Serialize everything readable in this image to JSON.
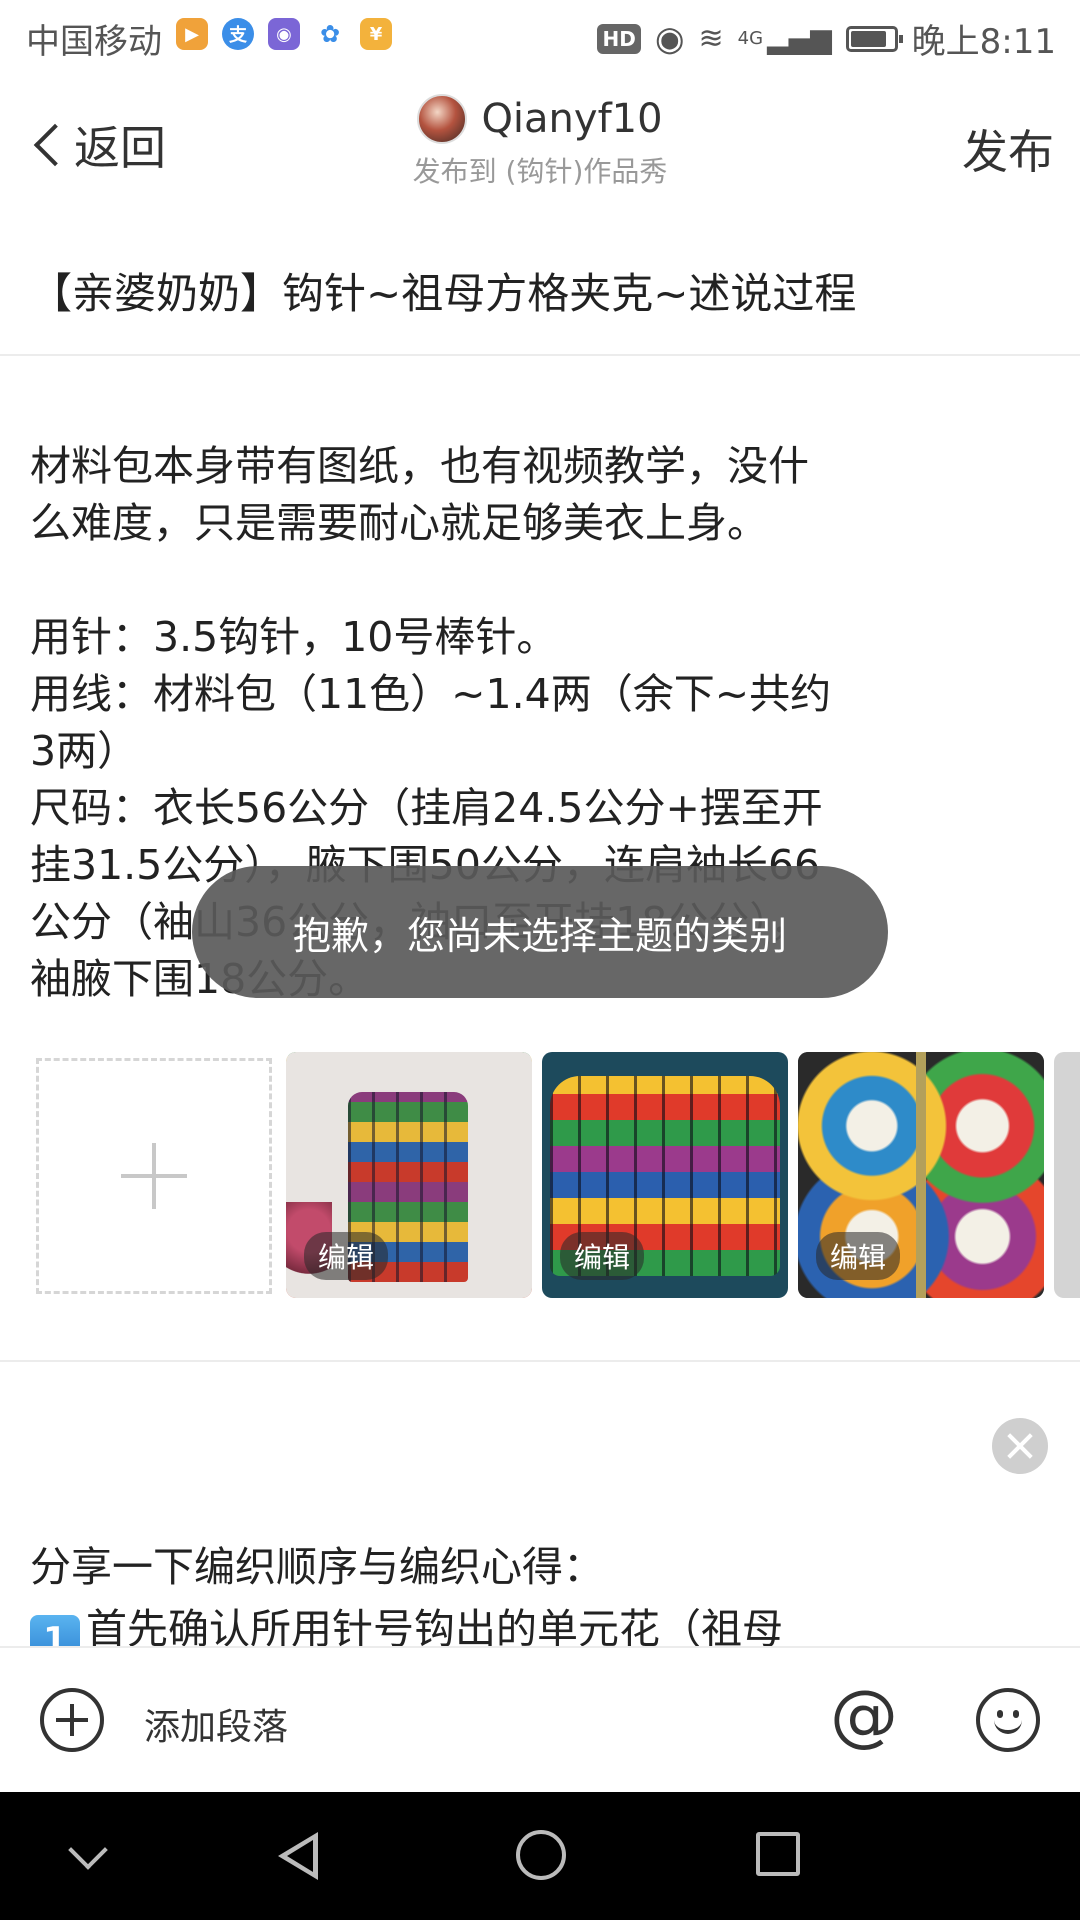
{
  "status_bar": {
    "carrier": "中国移动",
    "hd": "HD",
    "network": "4G",
    "time": "晚上8:11",
    "battery_level": 0.85,
    "app_icons": [
      "video-app-icon",
      "alipay-icon",
      "browser-icon",
      "baidu-paw-icon",
      "wallet-icon"
    ]
  },
  "header": {
    "back_label": "返回",
    "author": "Qianyf10",
    "publish_to": "发布到 (钩针)作品秀",
    "publish_label": "发布"
  },
  "post": {
    "title": "【亲婆奶奶】钩针~祖母方格夹克~述说过程",
    "body_lines": [
      "材料包本身带有图纸，也有视频教学，没什",
      "么难度，只是需要耐心就足够美衣上身。",
      "",
      "用针：3.5钩针，10号棒针。",
      "用线：材料包（11色）~1.4两（余下~共约",
      "3两）",
      "尺码：衣长56公分（挂肩24.5公分+摆至开",
      "挂31.5公分），腋下围50公分，连肩袖长66",
      "公分（袖山36公分，袖口至开挂18公分），",
      "袖腋下围18公分。"
    ],
    "image_edit_labels": [
      "编辑",
      "编辑",
      "编辑"
    ],
    "section2_line1": "分享一下编织顺序与编织心得：",
    "section2_badge": "1",
    "section2_line2": "首先确认所用针号钩出的单元花（祖母"
  },
  "toast": "抱歉，您尚未选择主题的类别",
  "toolbar": {
    "add_paragraph": "添加段落",
    "at_symbol": "@"
  },
  "colors": {
    "toast_bg": "#5a5a5a",
    "divider": "#ececec",
    "navbar_bg": "#000000"
  }
}
